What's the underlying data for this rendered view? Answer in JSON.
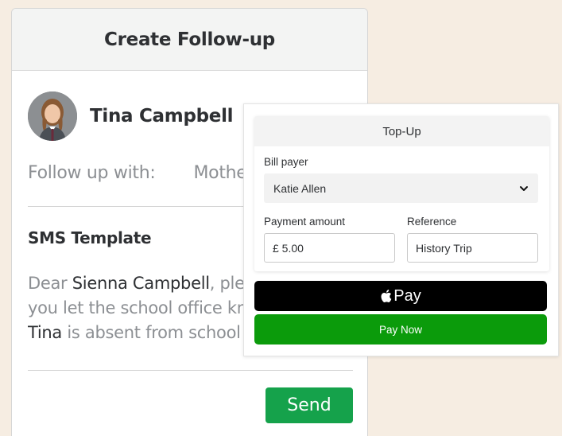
{
  "followup": {
    "title": "Create Follow-up",
    "student_name": "Tina Campbell",
    "follow_up_label": "Follow up with:",
    "follow_up_value": "Mother",
    "sms_title": "SMS Template",
    "sms_line1_a": "Dear ",
    "sms_line1_name": "Sienna Campbell",
    "sms_line1_b": ", please can",
    "sms_line2": "you let the school office know why",
    "sms_line3_name": "Tina",
    "sms_line3_b": " is absent from school today.",
    "send_label": "Send"
  },
  "topup": {
    "title": "Top-Up",
    "bill_payer_label": "Bill payer",
    "bill_payer_value": "Katie Allen",
    "payment_amount_label": "Payment amount",
    "payment_amount_value": "£ 5.00",
    "reference_label": "Reference",
    "reference_value": "History Trip",
    "applepay_label": "Pay",
    "paynow_label": "Pay Now"
  },
  "colors": {
    "background": "#f6ede2",
    "send_green": "#15a24b",
    "paynow_green": "#0b9b0b",
    "text_dark": "#2e3033",
    "text_muted": "#8c8f93"
  },
  "icons": {
    "avatar": "student-photo",
    "dropdown": "chevron-down-icon",
    "apple": "apple-logo-icon"
  }
}
